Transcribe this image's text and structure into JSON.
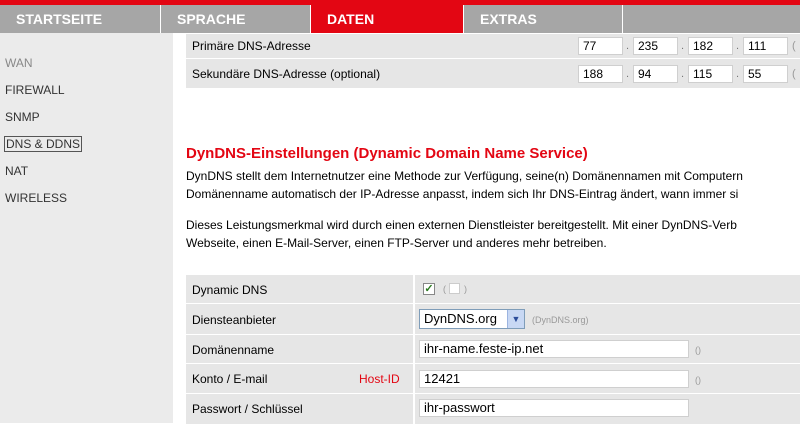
{
  "nav": {
    "tabs": [
      {
        "label": "STARTSEITE"
      },
      {
        "label": "SPRACHE"
      },
      {
        "label": "DATEN"
      },
      {
        "label": "EXTRAS"
      }
    ],
    "active_tab": "DATEN",
    "accent_color": "#e30613"
  },
  "sidebar": {
    "items": [
      {
        "label": "WAN"
      },
      {
        "label": "FIREWALL"
      },
      {
        "label": "SNMP"
      },
      {
        "label": "DNS & DDNS"
      },
      {
        "label": "NAT"
      },
      {
        "label": "WIRELESS"
      }
    ],
    "active_item": "DNS & DDNS"
  },
  "dns": {
    "primary_label": "Primäre DNS-Adresse",
    "primary_octets": [
      "77",
      "235",
      "182",
      "111"
    ],
    "secondary_label": "Sekundäre DNS-Adresse (optional)",
    "secondary_octets": [
      "188",
      "94",
      "115",
      "55"
    ],
    "separator": ".",
    "trailing_hint": "("
  },
  "ddns": {
    "title": "DynDNS-Einstellungen (Dynamic Domain Name Service)",
    "para1_line1": "DynDNS stellt dem Internetnutzer eine Methode zur Verfügung, seine(n) Domänennamen mit Computern",
    "para1_line2": "Domänenname automatisch der IP-Adresse anpasst, indem sich Ihr DNS-Eintrag ändert, wann immer si",
    "para2_line1": "Dieses Leistungsmerkmal wird durch einen externen Dienstleister bereitgestellt. Mit einer DynDNS-Verb",
    "para2_line2": "Webseite, einen E-Mail-Server, einen FTP-Server und anderes mehr betreiben.",
    "fields": {
      "dynamic_dns_label": "Dynamic DNS",
      "dynamic_dns_checked": true,
      "dynamic_dns_hint_open": "(",
      "dynamic_dns_hint_close": ")",
      "provider_label": "Diensteanbieter",
      "provider_value": "DynDNS.org",
      "provider_hint": "(DynDNS.org)",
      "domain_label": "Domänenname",
      "domain_value": "ihr-name.feste-ip.net",
      "domain_hint": "()",
      "account_label": "Konto / E-mail",
      "host_id_label": "Host-ID",
      "account_value": "12421",
      "account_hint": "()",
      "password_label": "Passwort / Schlüssel",
      "password_value": "ihr-passwort"
    }
  }
}
